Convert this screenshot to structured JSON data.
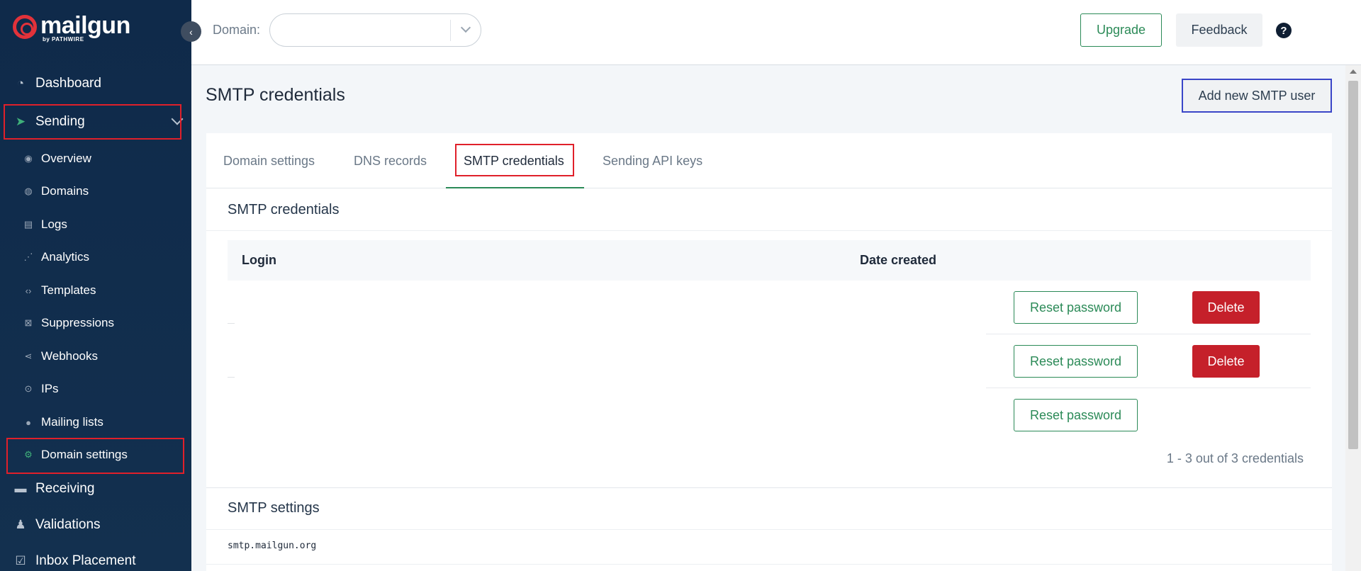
{
  "brand": {
    "name": "mailgun",
    "sub": "by PATHWIRE",
    "collapse_glyph": "‹"
  },
  "sidebar": {
    "top_items": [
      {
        "label": "Dashboard",
        "icon": "dashboard-icon"
      },
      {
        "label": "Sending",
        "icon": "paper-plane-icon",
        "expanded": true
      },
      {
        "label": "Receiving",
        "icon": "inbox-icon"
      },
      {
        "label": "Validations",
        "icon": "user-check-icon"
      },
      {
        "label": "Inbox Placement",
        "icon": "checkbox-icon"
      }
    ],
    "sub_items": [
      {
        "label": "Overview",
        "icon": "eye-icon"
      },
      {
        "label": "Domains",
        "icon": "globe-icon"
      },
      {
        "label": "Logs",
        "icon": "document-icon"
      },
      {
        "label": "Analytics",
        "icon": "chart-icon"
      },
      {
        "label": "Templates",
        "icon": "code-icon"
      },
      {
        "label": "Suppressions",
        "icon": "x-square-icon"
      },
      {
        "label": "Webhooks",
        "icon": "share-icon"
      },
      {
        "label": "IPs",
        "icon": "location-pin-icon"
      },
      {
        "label": "Mailing lists",
        "icon": "person-icon"
      },
      {
        "label": "Domain settings",
        "icon": "gear-icon",
        "active": true
      }
    ]
  },
  "topbar": {
    "domain_label": "Domain:",
    "domain_value": "",
    "upgrade_label": "Upgrade",
    "feedback_label": "Feedback",
    "help_glyph": "?"
  },
  "main": {
    "title": "SMTP credentials",
    "add_button_label": "Add new SMTP user",
    "tabs": [
      {
        "label": "Domain settings"
      },
      {
        "label": "DNS records"
      },
      {
        "label": "SMTP credentials",
        "active": true
      },
      {
        "label": "Sending API keys"
      }
    ],
    "credentials_section": {
      "title": "SMTP credentials",
      "columns": [
        "Login",
        "Date created"
      ],
      "rows": [
        {
          "login": "",
          "date_created": "",
          "reset_label": "Reset password",
          "delete_label": "Delete"
        },
        {
          "login": "",
          "date_created": "",
          "reset_label": "Reset password",
          "delete_label": "Delete"
        },
        {
          "login": "",
          "date_created": "",
          "reset_label": "Reset password"
        }
      ],
      "count_text": "1 - 3 out of 3 credentials"
    },
    "settings_section": {
      "title": "SMTP settings",
      "hostname": "smtp.mailgun.org"
    }
  },
  "colors": {
    "sidebar_bg": "#0f2a4a",
    "accent_green": "#2b8a57",
    "danger_red": "#c5202a",
    "highlight_red": "#e0202a",
    "highlight_blue": "#3a46c8"
  }
}
